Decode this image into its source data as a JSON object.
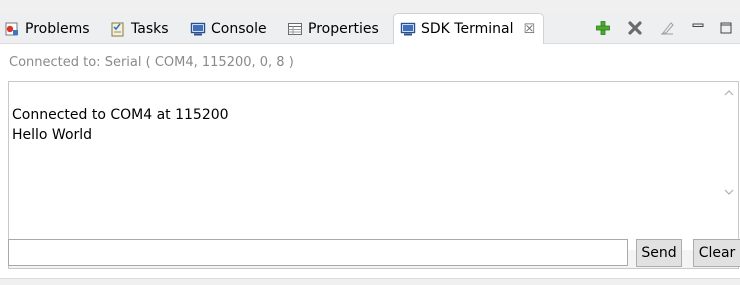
{
  "tabs": [
    {
      "label": "Problems",
      "icon": "problems-icon"
    },
    {
      "label": "Tasks",
      "icon": "tasks-icon"
    },
    {
      "label": "Console",
      "icon": "console-icon"
    },
    {
      "label": "Properties",
      "icon": "properties-icon"
    },
    {
      "label": "SDK Terminal",
      "icon": "terminal-icon",
      "active": true,
      "close": "☒"
    }
  ],
  "toolbar": {
    "icons": [
      "add-icon",
      "remove-icon",
      "clear-icon",
      "minimize-icon",
      "maximize-icon"
    ]
  },
  "status": {
    "connection": "Connected to: Serial (  COM4, 115200, 0, 8 )"
  },
  "terminal": {
    "lines": [
      "Connected to COM4 at 115200",
      "Hello World"
    ]
  },
  "command": {
    "value": "",
    "send_label": "Send",
    "clear_label": "Clear"
  },
  "colors": {
    "add": "#4caa2e",
    "remove": "#6b6b6b",
    "tab_active_bg": "#ffffff",
    "tabbar_bg": "#eeeff1"
  }
}
